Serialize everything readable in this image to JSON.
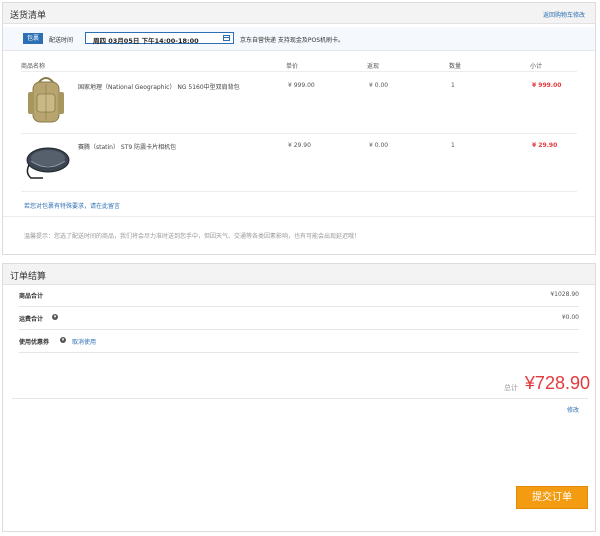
{
  "delivery": {
    "title": "送货清单",
    "back_link": "返回购物车修改",
    "badge": "包裹",
    "time_label": "配送时间",
    "time_value": "周四 03月05日 下午14:00-18:00",
    "note": "京东自营快递 支持现金及POS机刷卡。"
  },
  "table": {
    "headers": [
      "商品名称",
      "单价",
      "返现",
      "数量",
      "小计"
    ],
    "rows": [
      {
        "name": "国家地理（National Geographic） NG 5160中型双肩背包",
        "price": "¥ 999.00",
        "cashback": "¥ 0.00",
        "qty": "1",
        "subtotal": "¥ 999.00",
        "thumb_icon": "backpack-icon"
      },
      {
        "name": "赛腾（statin） ST9 防震卡片相机包",
        "price": "¥ 29.90",
        "cashback": "¥ 0.00",
        "qty": "1",
        "subtotal": "¥ 29.90",
        "thumb_icon": "camera-case-icon"
      }
    ]
  },
  "message_link": "若您对包裹有特殊要求，请在此留言",
  "tip": "温馨提示：您选了配送时间的商品，我们将会尽力准时送到您手中，但因天气、交通等各类因素影响，也有可能会出现延迟哦！",
  "summary": {
    "title": "订单结算",
    "goods_label": "商品合计",
    "goods_value": "¥1028.90",
    "shipping_label": "运费合计",
    "shipping_value": "¥0.00",
    "coupon_label": "使用优惠券",
    "coupon_cancel": "取消使用",
    "total_label": "总计",
    "total_value": "¥728.90",
    "modify": "修改",
    "submit": "提交订单"
  },
  "colors": {
    "accent_blue": "#2d6fb4",
    "price_red": "#e4393c",
    "submit_orange": "#f39c12"
  }
}
